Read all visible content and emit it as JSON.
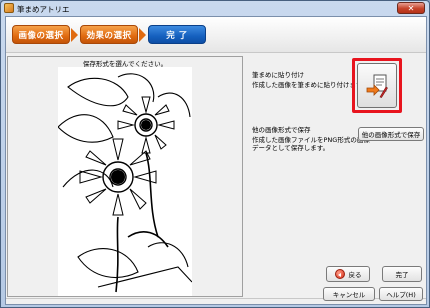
{
  "window": {
    "title": "筆まめアトリエ",
    "close_symbol": "✕"
  },
  "steps": [
    {
      "label": "画像の選択",
      "state": "done",
      "color": "#e06a10"
    },
    {
      "label": "効果の選択",
      "state": "done",
      "color": "#e06a10"
    },
    {
      "label": "完 了",
      "state": "current",
      "color": "#1560bf"
    }
  ],
  "preview": {
    "caption": "保存形式を選んでください。"
  },
  "options": {
    "paste": {
      "title": "筆まめに貼り付け",
      "description": "作成した画像を筆まめに貼り付けます。",
      "icon": "paste-to-fudemame-icon"
    },
    "save_other": {
      "title": "他の画像形式で保存",
      "description_line1": "作成した画像ファイルをPNG形式の画像",
      "description_line2": "データとして保存します。",
      "button_label": "他の画像形式で保存"
    }
  },
  "nav": {
    "back_label": "戻る",
    "finish_label": "完了"
  },
  "footer": {
    "cancel_label": "キャンセル",
    "help_label": "ヘルプ(H)"
  },
  "colors": {
    "highlight": "#e8141e",
    "step_done": "#e06a10",
    "step_current": "#1560bf"
  }
}
